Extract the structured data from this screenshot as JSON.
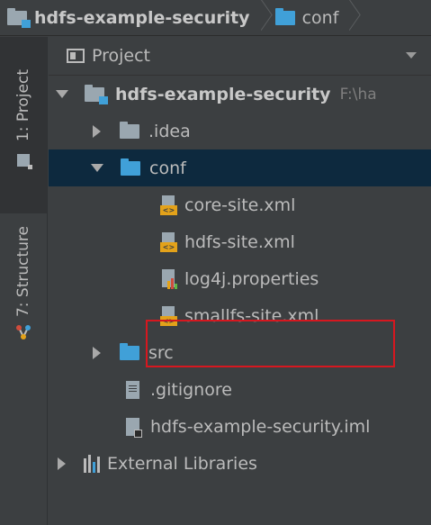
{
  "breadcrumb": {
    "project": "hdfs-example-security",
    "folder": "conf"
  },
  "toolstrip": {
    "project_tab": "1: Project",
    "structure_tab": "7: Structure"
  },
  "panel": {
    "title": "Project"
  },
  "tree": {
    "root": {
      "label": "hdfs-example-security",
      "path_hint": "F:\\ha"
    },
    "idea": {
      "label": ".idea"
    },
    "conf": {
      "label": "conf"
    },
    "files": [
      {
        "label": "core-site.xml"
      },
      {
        "label": "hdfs-site.xml"
      },
      {
        "label": "log4j.properties"
      },
      {
        "label": "smallfs-site.xml"
      }
    ],
    "src": {
      "label": "src"
    },
    "gitignore": {
      "label": ".gitignore"
    },
    "iml": {
      "label": "hdfs-example-security.iml"
    },
    "external": {
      "label": "External Libraries"
    }
  },
  "colors": {
    "background": "#3c3f41",
    "selection": "#0d293e",
    "folder_blue": "#40a0d8",
    "highlight_border": "#d7171f",
    "xml_tag": "#e3a21a"
  }
}
